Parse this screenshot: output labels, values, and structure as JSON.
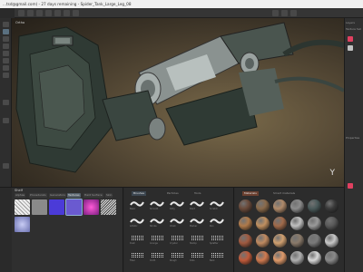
{
  "window": {
    "title": "...tsd@gmail.com) - 27 days remaining - Spider_Tank_Large_Leg_08"
  },
  "viewport": {
    "label": "Ortho",
    "axis_gizmo": "Y"
  },
  "shelf": {
    "title": "Shelf",
    "tabs": [
      "Alphas",
      "Procedurals",
      "Generators",
      "Textures",
      "Hard Surface",
      "Skin"
    ],
    "active_tab": "Textures",
    "tiles": [
      {
        "color": "#d7d7d7"
      },
      {
        "color": "#8a8a8a"
      },
      {
        "color": "#4b3bd8"
      },
      {
        "color": "#6a5ad0"
      },
      {
        "color": "#c23bbd"
      },
      {
        "color": "#e0e0e0"
      },
      {
        "color": "#aab0e8"
      }
    ]
  },
  "brushes": {
    "tabs": [
      "Brushes",
      "Particles",
      "Tools"
    ],
    "active_tab": "Brushes",
    "items": [
      {
        "label": "Basic"
      },
      {
        "label": "Smooth"
      },
      {
        "label": "Dirty"
      },
      {
        "label": "Paint"
      },
      {
        "label": "Scratch"
      },
      {
        "label": "Artistic"
      },
      {
        "label": "Stroke"
      },
      {
        "label": "Chalk"
      },
      {
        "label": "Marker"
      },
      {
        "label": "Pen"
      },
      {
        "label": "Dust"
      },
      {
        "label": "Grunge"
      },
      {
        "label": "Crystal"
      },
      {
        "label": "Stamp"
      },
      {
        "label": "Splatter"
      },
      {
        "label": "Fiber"
      },
      {
        "label": "Cloth"
      },
      {
        "label": "Rough"
      },
      {
        "label": "Dots"
      },
      {
        "label": "Bark"
      }
    ]
  },
  "materials": {
    "tabs": [
      "Materials",
      "Smart materials"
    ],
    "active_tab": "Materials",
    "spheres": [
      {
        "color": "#6a4a3a"
      },
      {
        "color": "#8a6a4a"
      },
      {
        "color": "#b08a6a"
      },
      {
        "color": "#8c8c8c"
      },
      {
        "color": "#4a5a5a"
      },
      {
        "color": "#3a3a3a"
      },
      {
        "color": "#b07a4a"
      },
      {
        "color": "#c09060"
      },
      {
        "color": "#a06a4a"
      },
      {
        "color": "#c0c0c0"
      },
      {
        "color": "#9a9a9a"
      },
      {
        "color": "#5a5a5a"
      },
      {
        "color": "#a05a40"
      },
      {
        "color": "#c08a60"
      },
      {
        "color": "#d0a070"
      },
      {
        "color": "#8a7a6a"
      },
      {
        "color": "#7a7a7a"
      },
      {
        "color": "#c8c8c8"
      },
      {
        "color": "#c05a3a"
      },
      {
        "color": "#d07a50"
      },
      {
        "color": "#e09a6a"
      },
      {
        "color": "#b0b0b0"
      },
      {
        "color": "#d8d8d8"
      },
      {
        "color": "#8a8a8a"
      }
    ]
  },
  "right_panel": {
    "tabs": [
      "Layers",
      "Texture Set",
      "Properties"
    ],
    "accent_colors": [
      "#e04060",
      "#c0c0c0"
    ]
  }
}
